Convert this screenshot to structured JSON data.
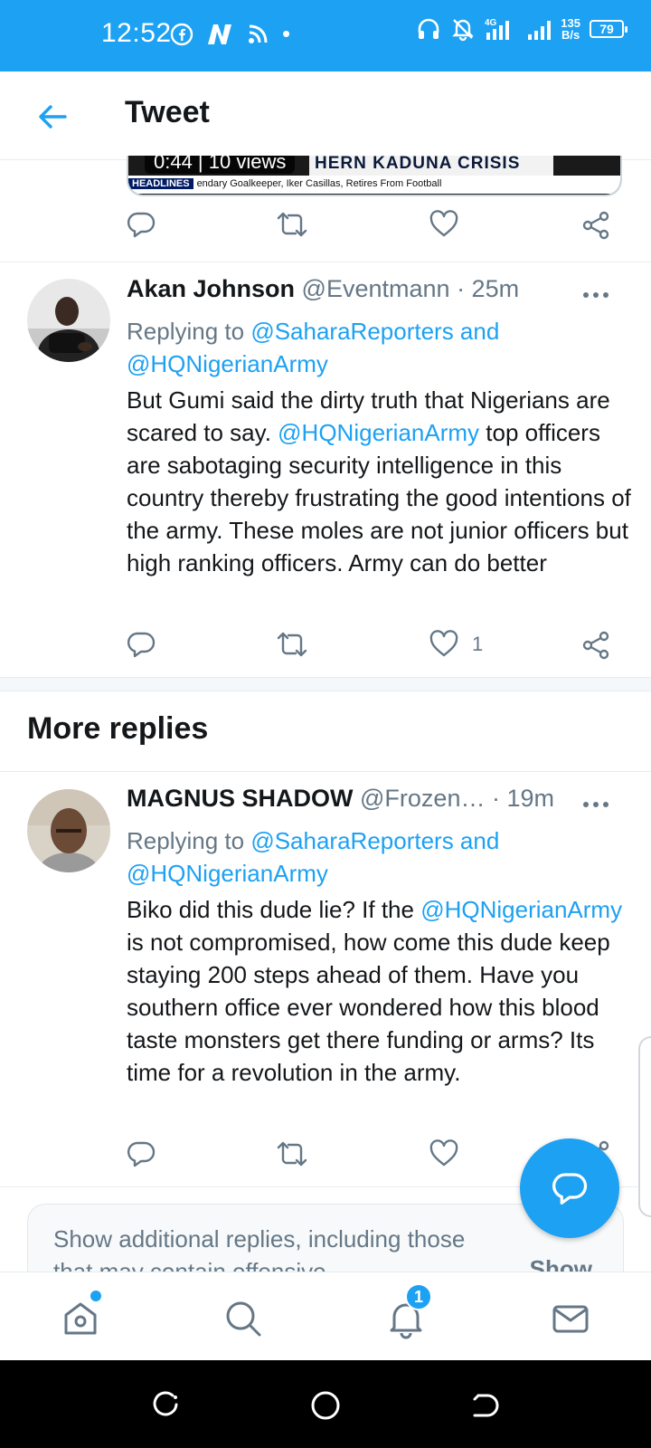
{
  "status_bar": {
    "time": "12:52",
    "network_speed": "135",
    "network_unit": "B/s",
    "network_type": "4G",
    "battery": "79",
    "dot": "•"
  },
  "header": {
    "title": "Tweet"
  },
  "top_media": {
    "views": "0:44 | 10 views",
    "banner": "HERN KADUNA CRISIS",
    "ticker_tag": "HEADLINES",
    "ticker_text": "endary Goalkeeper, Iker Casillas, Retires From Football"
  },
  "tweets": [
    {
      "name": "Akan Johnson",
      "handle": "@Eventmann",
      "time": "· 25m",
      "replying_prefix": "Replying to ",
      "replying_to_1": "@SaharaReporters and",
      "replying_to_2": "@HQNigerianArmy",
      "body_1": "But Gumi said the dirty truth that Nigerians are scared to say. ",
      "body_mention": "@HQNigerianArmy",
      "body_2": " top officers are sabotaging security intelligence in this country thereby frustrating the good intentions of the army. These moles are not junior officers but high ranking officers. Army can do better",
      "like_count": "1"
    },
    {
      "name": "MAGNUS SHADOW",
      "handle": "@Frozen…",
      "time": "· 19m",
      "replying_prefix": "Replying to ",
      "replying_to_1": "@SaharaReporters and",
      "replying_to_2": "@HQNigerianArmy",
      "body_1": "Biko did this dude lie? If the ",
      "body_mention": "@HQNigerianArmy",
      "body_2": " is not compromised, how come this dude keep staying 200 steps ahead of them. Have you southern office ever wondered how this blood taste monsters get there funding or arms? Its time for a revolution in the army.",
      "like_count": ""
    }
  ],
  "more_replies_title": "More replies",
  "additional_replies": {
    "text": "Show additional replies, including those that may contain offensive",
    "button": "Show"
  },
  "bottom_nav": {
    "notifications_badge": "1"
  },
  "colors": {
    "brand": "#1da1f2",
    "text": "#14171a",
    "secondary": "#657786"
  }
}
